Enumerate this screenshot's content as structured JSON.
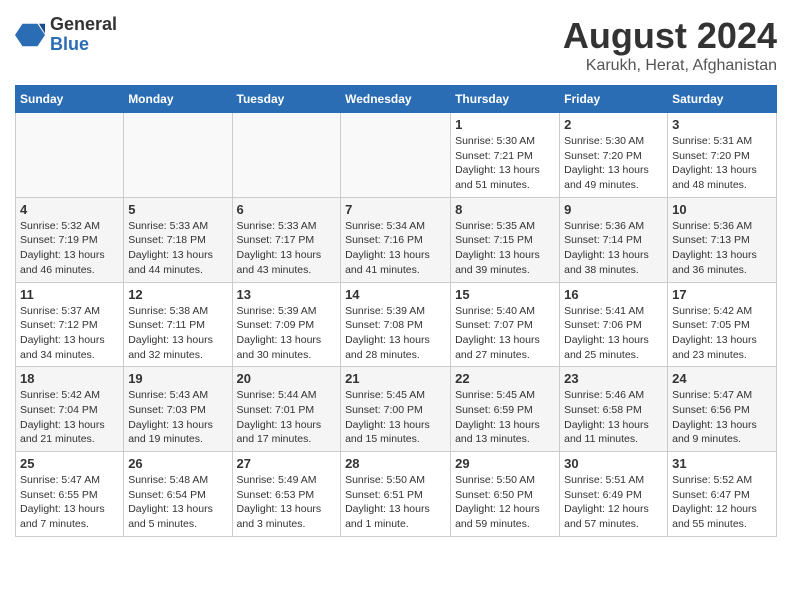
{
  "header": {
    "logo_general": "General",
    "logo_blue": "Blue",
    "month": "August 2024",
    "location": "Karukh, Herat, Afghanistan"
  },
  "days_of_week": [
    "Sunday",
    "Monday",
    "Tuesday",
    "Wednesday",
    "Thursday",
    "Friday",
    "Saturday"
  ],
  "weeks": [
    [
      {
        "day": "",
        "info": ""
      },
      {
        "day": "",
        "info": ""
      },
      {
        "day": "",
        "info": ""
      },
      {
        "day": "",
        "info": ""
      },
      {
        "day": "1",
        "info": "Sunrise: 5:30 AM\nSunset: 7:21 PM\nDaylight: 13 hours\nand 51 minutes."
      },
      {
        "day": "2",
        "info": "Sunrise: 5:30 AM\nSunset: 7:20 PM\nDaylight: 13 hours\nand 49 minutes."
      },
      {
        "day": "3",
        "info": "Sunrise: 5:31 AM\nSunset: 7:20 PM\nDaylight: 13 hours\nand 48 minutes."
      }
    ],
    [
      {
        "day": "4",
        "info": "Sunrise: 5:32 AM\nSunset: 7:19 PM\nDaylight: 13 hours\nand 46 minutes."
      },
      {
        "day": "5",
        "info": "Sunrise: 5:33 AM\nSunset: 7:18 PM\nDaylight: 13 hours\nand 44 minutes."
      },
      {
        "day": "6",
        "info": "Sunrise: 5:33 AM\nSunset: 7:17 PM\nDaylight: 13 hours\nand 43 minutes."
      },
      {
        "day": "7",
        "info": "Sunrise: 5:34 AM\nSunset: 7:16 PM\nDaylight: 13 hours\nand 41 minutes."
      },
      {
        "day": "8",
        "info": "Sunrise: 5:35 AM\nSunset: 7:15 PM\nDaylight: 13 hours\nand 39 minutes."
      },
      {
        "day": "9",
        "info": "Sunrise: 5:36 AM\nSunset: 7:14 PM\nDaylight: 13 hours\nand 38 minutes."
      },
      {
        "day": "10",
        "info": "Sunrise: 5:36 AM\nSunset: 7:13 PM\nDaylight: 13 hours\nand 36 minutes."
      }
    ],
    [
      {
        "day": "11",
        "info": "Sunrise: 5:37 AM\nSunset: 7:12 PM\nDaylight: 13 hours\nand 34 minutes."
      },
      {
        "day": "12",
        "info": "Sunrise: 5:38 AM\nSunset: 7:11 PM\nDaylight: 13 hours\nand 32 minutes."
      },
      {
        "day": "13",
        "info": "Sunrise: 5:39 AM\nSunset: 7:09 PM\nDaylight: 13 hours\nand 30 minutes."
      },
      {
        "day": "14",
        "info": "Sunrise: 5:39 AM\nSunset: 7:08 PM\nDaylight: 13 hours\nand 28 minutes."
      },
      {
        "day": "15",
        "info": "Sunrise: 5:40 AM\nSunset: 7:07 PM\nDaylight: 13 hours\nand 27 minutes."
      },
      {
        "day": "16",
        "info": "Sunrise: 5:41 AM\nSunset: 7:06 PM\nDaylight: 13 hours\nand 25 minutes."
      },
      {
        "day": "17",
        "info": "Sunrise: 5:42 AM\nSunset: 7:05 PM\nDaylight: 13 hours\nand 23 minutes."
      }
    ],
    [
      {
        "day": "18",
        "info": "Sunrise: 5:42 AM\nSunset: 7:04 PM\nDaylight: 13 hours\nand 21 minutes."
      },
      {
        "day": "19",
        "info": "Sunrise: 5:43 AM\nSunset: 7:03 PM\nDaylight: 13 hours\nand 19 minutes."
      },
      {
        "day": "20",
        "info": "Sunrise: 5:44 AM\nSunset: 7:01 PM\nDaylight: 13 hours\nand 17 minutes."
      },
      {
        "day": "21",
        "info": "Sunrise: 5:45 AM\nSunset: 7:00 PM\nDaylight: 13 hours\nand 15 minutes."
      },
      {
        "day": "22",
        "info": "Sunrise: 5:45 AM\nSunset: 6:59 PM\nDaylight: 13 hours\nand 13 minutes."
      },
      {
        "day": "23",
        "info": "Sunrise: 5:46 AM\nSunset: 6:58 PM\nDaylight: 13 hours\nand 11 minutes."
      },
      {
        "day": "24",
        "info": "Sunrise: 5:47 AM\nSunset: 6:56 PM\nDaylight: 13 hours\nand 9 minutes."
      }
    ],
    [
      {
        "day": "25",
        "info": "Sunrise: 5:47 AM\nSunset: 6:55 PM\nDaylight: 13 hours\nand 7 minutes."
      },
      {
        "day": "26",
        "info": "Sunrise: 5:48 AM\nSunset: 6:54 PM\nDaylight: 13 hours\nand 5 minutes."
      },
      {
        "day": "27",
        "info": "Sunrise: 5:49 AM\nSunset: 6:53 PM\nDaylight: 13 hours\nand 3 minutes."
      },
      {
        "day": "28",
        "info": "Sunrise: 5:50 AM\nSunset: 6:51 PM\nDaylight: 13 hours\nand 1 minute."
      },
      {
        "day": "29",
        "info": "Sunrise: 5:50 AM\nSunset: 6:50 PM\nDaylight: 12 hours\nand 59 minutes."
      },
      {
        "day": "30",
        "info": "Sunrise: 5:51 AM\nSunset: 6:49 PM\nDaylight: 12 hours\nand 57 minutes."
      },
      {
        "day": "31",
        "info": "Sunrise: 5:52 AM\nSunset: 6:47 PM\nDaylight: 12 hours\nand 55 minutes."
      }
    ]
  ]
}
